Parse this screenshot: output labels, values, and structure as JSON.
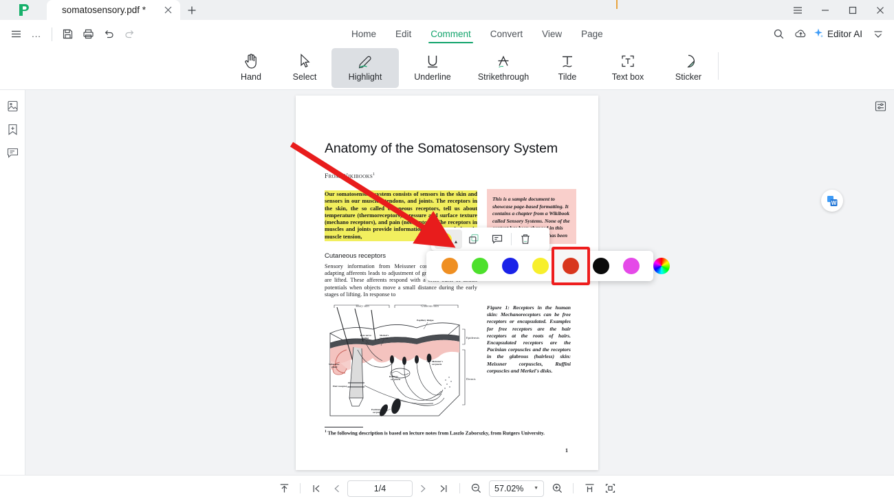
{
  "window": {
    "tab_title": "somatosensory.pdf *",
    "new_tab_icon": "plus-icon",
    "close_tab_icon": "close-icon",
    "menu_icon": "hamburger-icon",
    "minimize_icon": "minimize-icon",
    "maximize_icon": "maximize-icon",
    "close_icon": "close-icon"
  },
  "quick_access": {
    "menu_label": "hamburger-menu",
    "more_label": "...",
    "save_icon": "save-icon",
    "print_icon": "print-icon",
    "undo_icon": "undo-icon",
    "redo_icon": "redo-icon"
  },
  "ribbon_tabs": [
    {
      "label": "Home",
      "active": false
    },
    {
      "label": "Edit",
      "active": false
    },
    {
      "label": "Comment",
      "active": true
    },
    {
      "label": "Convert",
      "active": false
    },
    {
      "label": "View",
      "active": false
    },
    {
      "label": "Page",
      "active": false
    }
  ],
  "header_right": {
    "search_icon": "search-icon",
    "cloud_icon": "cloud-upload-icon",
    "ai_icon": "sparkle-icon",
    "ai_label": "Editor AI",
    "collapse_icon": "collapse-ribbon-icon"
  },
  "tools": [
    {
      "label": "Hand",
      "icon": "hand-icon",
      "selected": false
    },
    {
      "label": "Select",
      "icon": "cursor-arrow-icon",
      "selected": false
    },
    {
      "label": "Highlight",
      "icon": "highlighter-pen-icon",
      "selected": true
    },
    {
      "label": "Underline",
      "icon": "underline-icon",
      "selected": false
    },
    {
      "label": "Strikethrough",
      "icon": "strikethrough-icon",
      "selected": false
    },
    {
      "label": "Tilde",
      "icon": "tilde-icon",
      "selected": false
    },
    {
      "label": "Text box",
      "icon": "text-box-icon",
      "selected": false
    },
    {
      "label": "Sticker",
      "icon": "sticker-icon",
      "selected": false
    }
  ],
  "left_sidebar": [
    {
      "name": "thumbnails-panel",
      "icon": "page-thumbnail-icon"
    },
    {
      "name": "bookmarks-panel",
      "icon": "bookmark-add-icon"
    },
    {
      "name": "comments-panel",
      "icon": "comment-icon"
    }
  ],
  "right_sidebar": [
    {
      "name": "properties-panel",
      "icon": "sliders-icon"
    }
  ],
  "floating": {
    "convert_to_word_icon": "word-convert-icon"
  },
  "popup_toolbar": {
    "current_color": "#f4ec33",
    "color_dropdown_icon": "caret-up-icon",
    "copy_icon": "copy-icon",
    "note_icon": "comment-note-icon",
    "delete_icon": "trash-icon"
  },
  "color_palette": {
    "selected_index": 4,
    "selection_border": "#ee1d1d",
    "swatches": [
      {
        "name": "orange",
        "color": "#ef8f22"
      },
      {
        "name": "green",
        "color": "#4de02c"
      },
      {
        "name": "blue",
        "color": "#1a22e8"
      },
      {
        "name": "yellow",
        "color": "#f7ef2c"
      },
      {
        "name": "red",
        "color": "#d8361d"
      },
      {
        "name": "black",
        "color": "#0a0a0a"
      },
      {
        "name": "magenta",
        "color": "#e54ae8"
      },
      {
        "name": "custom-color-wheel",
        "color": "rainbow"
      }
    ]
  },
  "document": {
    "title": "Anatomy of the Somatosensory System",
    "from_line": "From Wikibooks",
    "from_footnote_marker": "1",
    "highlighted_paragraph": "Our somatosensory system consists of sensors in the skin and sensors in our muscles, tendons, and joints. The receptors in the skin, the so called cutaneous receptors, tell us about temperature (thermoreceptors), pressure and surface texture (mechano receptors), and pain (nociceptors). The receptors in muscles and joints provide information about muscle length, muscle tension,",
    "section_heading": "Cutaneous receptors",
    "body_paragraph": "Sensory information from Meissner corpuscles and rapidly adapting afferents leads to adjustment of grip force when objects are lifted. These afferents respond with a brief burst of action potentials when objects move a small distance during the early stages of lifting. In response to",
    "pink_note": "This is a sample document to showcase page-based formatting. It contains a chapter from a Wikibook called Sensory Systems. None of the content has been changed in this document but the content has been",
    "figure_caption": "Figure 1: Receptors in the human skin: Mechanoreceptors can be free receptors or encapsulated. Examples for free receptors are the hair receptors at the roots of hairs. Encapsulated receptors are the Pacinian corpuscles and the receptors in the glabrous (hairless) skin: Meissner corpuscles, Ruffini corpuscles and Merkel's disks.",
    "footnote_marker": "1",
    "footnote": "The following description is based on lecture notes from Laszlo Zaborszky, from Rutgers University.",
    "page_number": "1",
    "figure_labels": {
      "hairy_skin": "Hairy skin",
      "glabrous_skin": "Glabrous skin",
      "epidermis": "Epidermis",
      "dermis": "Dermis",
      "papillary_ridges": "Papillary Ridges",
      "free_nerve_ending": "Free nerve ending",
      "merkel": "Merkel's receptor",
      "sebaceous_gland": "Sebaceous gland",
      "hair_receptor": "Hair receptor",
      "pacinian": "Pacinian corpuscle",
      "ruffini": "Ruffini's corpuscle",
      "meissner": "Meissner's corpuscle"
    }
  },
  "bottom_bar": {
    "scroll_top_icon": "scroll-to-top-icon",
    "first_page_icon": "first-page-icon",
    "prev_page_icon": "previous-page-icon",
    "page_value": "1/4",
    "next_page_icon": "next-page-icon",
    "last_page_icon": "last-page-icon",
    "zoom_out_icon": "zoom-out-icon",
    "zoom_value": "57.02%",
    "zoom_caret_icon": "caret-down-icon",
    "zoom_in_icon": "zoom-in-icon",
    "fit_width_icon": "fit-width-icon",
    "fit_page_icon": "fit-page-icon"
  },
  "annotation": {
    "arrow_color": "#e81c1c"
  }
}
